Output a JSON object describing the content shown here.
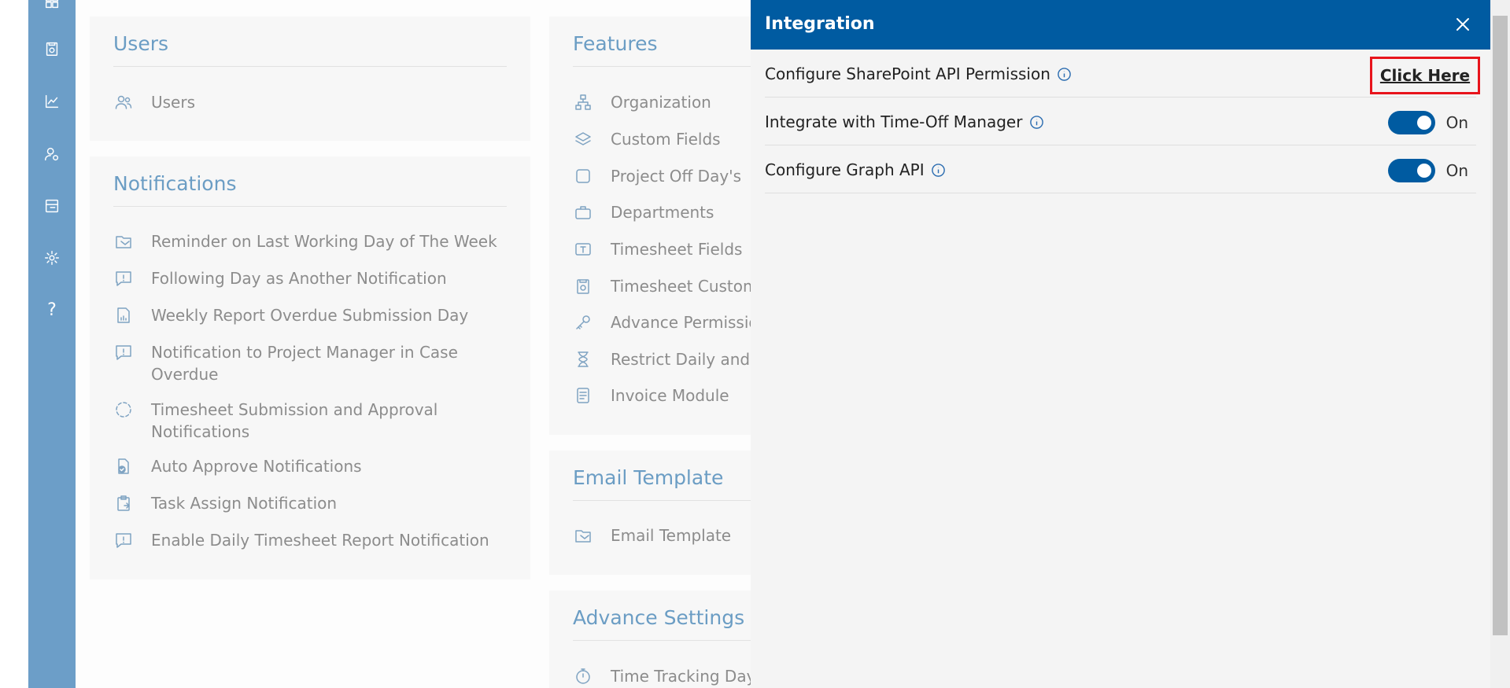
{
  "rail": {
    "icons": [
      "grid-icon",
      "timesheet-icon",
      "chart-icon",
      "user-settings-icon",
      "layout-icon",
      "gear-icon",
      "help-icon"
    ],
    "help_glyph": "?"
  },
  "users_card": {
    "title": "Users",
    "items": [
      {
        "label": "Users",
        "icon": "users-icon"
      }
    ]
  },
  "notifications_card": {
    "title": "Notifications",
    "items": [
      {
        "label": "Reminder on Last Working Day of The Week",
        "icon": "mail-folder-icon"
      },
      {
        "label": "Following Day as Another Notification",
        "icon": "comment-alert-icon"
      },
      {
        "label": "Weekly Report Overdue Submission Day",
        "icon": "report-icon"
      },
      {
        "label": "Notification to Project Manager in Case Overdue",
        "icon": "comment-alert-icon"
      },
      {
        "label": "Timesheet Submission and Approval Notifications",
        "icon": "dashed-circle-icon"
      },
      {
        "label": "Auto Approve Notifications",
        "icon": "doc-check-icon"
      },
      {
        "label": "Task Assign Notification",
        "icon": "clipboard-icon"
      },
      {
        "label": "Enable Daily Timesheet Report Notification",
        "icon": "comment-alert-icon"
      }
    ]
  },
  "features_card": {
    "title": "Features",
    "items": [
      {
        "label": "Organization",
        "icon": "org-chart-icon"
      },
      {
        "label": "Custom Fields",
        "icon": "layers-icon"
      },
      {
        "label": "Project Off Day's",
        "icon": "square-icon"
      },
      {
        "label": "Departments",
        "icon": "briefcase-icon"
      },
      {
        "label": "Timesheet Fields",
        "icon": "text-field-icon"
      },
      {
        "label": "Timesheet Customi",
        "icon": "timesheet-icon"
      },
      {
        "label": "Advance Permission",
        "icon": "key-icon"
      },
      {
        "label": "Restrict Daily and W",
        "icon": "hourglass-icon"
      },
      {
        "label": "Invoice Module",
        "icon": "invoice-icon"
      }
    ]
  },
  "email_card": {
    "title": "Email Template",
    "items": [
      {
        "label": "Email Template",
        "icon": "mail-folder-icon"
      }
    ]
  },
  "advance_card": {
    "title": "Advance Settings",
    "items": [
      {
        "label": "Time Tracking Days",
        "icon": "stopwatch-icon"
      }
    ]
  },
  "panel": {
    "title": "Integration",
    "rows": [
      {
        "label": "Configure SharePoint API Permission",
        "action": "Click Here"
      },
      {
        "label": "Integrate with Time-Off Manager",
        "toggle": "On",
        "enabled": true
      },
      {
        "label": "Configure Graph API",
        "toggle": "On",
        "enabled": true
      }
    ]
  },
  "colors": {
    "rail": "#6c9ec8",
    "panel_header": "#005ba1",
    "accent_title": "#6b9dc4",
    "highlight_border": "#e8141c"
  }
}
